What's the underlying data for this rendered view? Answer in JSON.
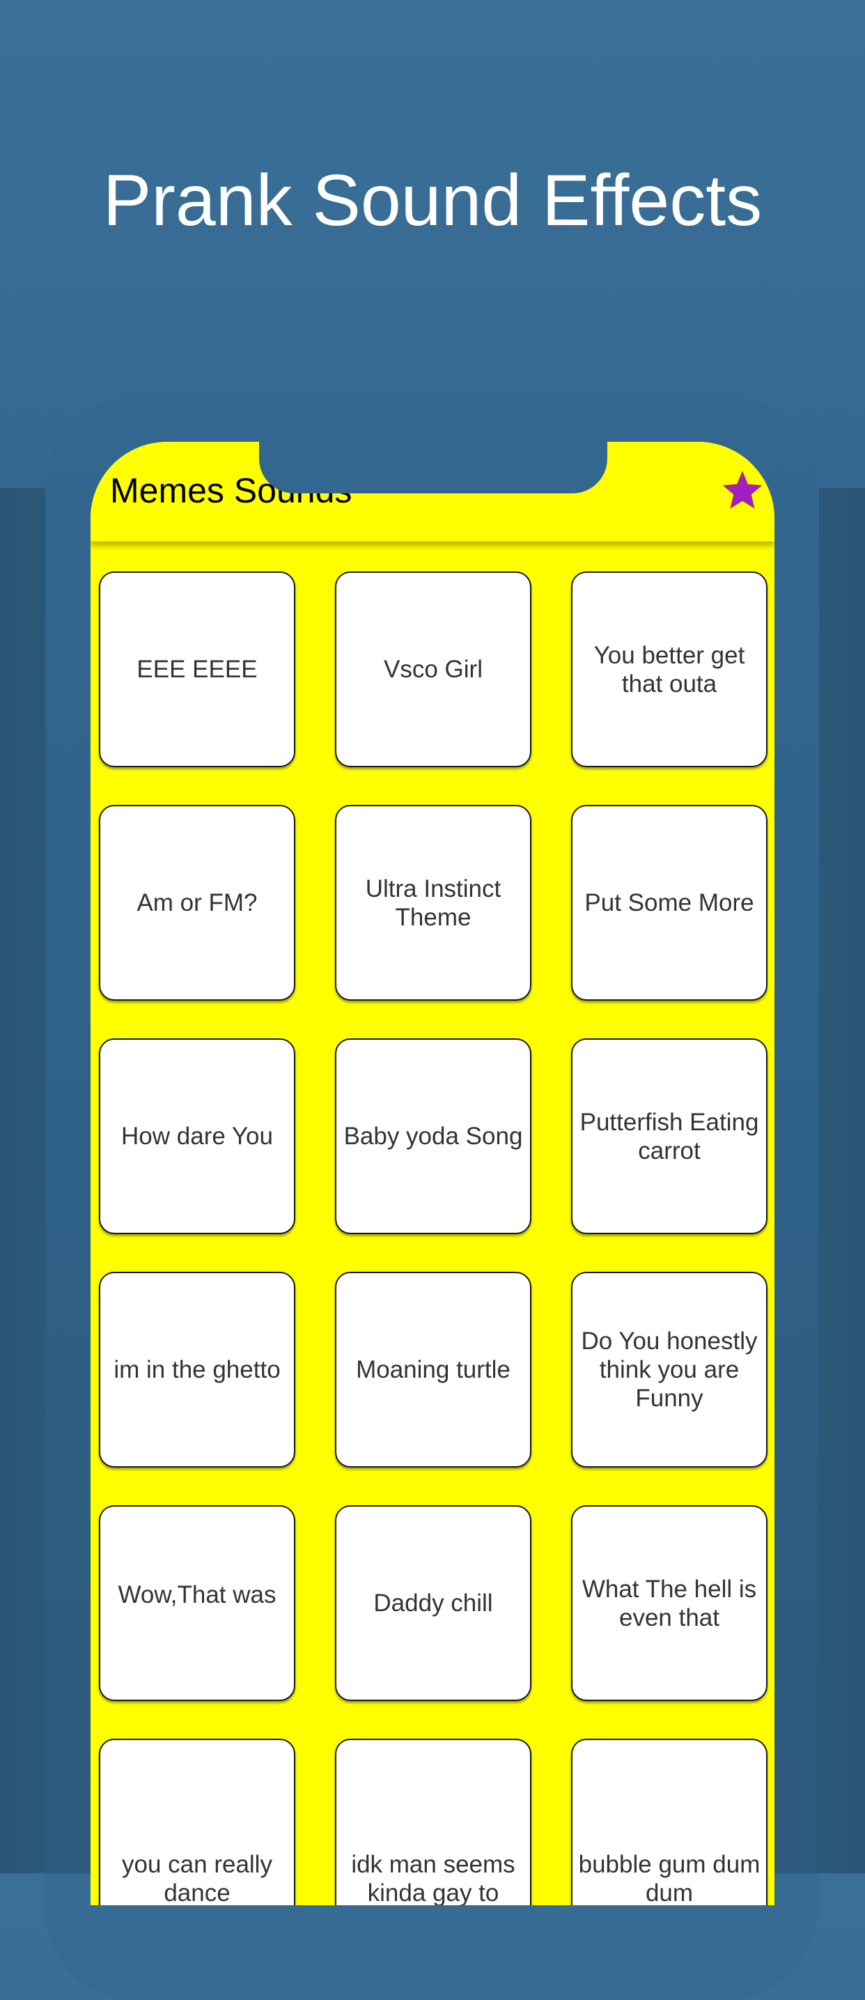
{
  "headline": "Prank Sound Effects",
  "colors": {
    "background": "#346790",
    "screen": "#ffff00",
    "star": "#a020c0",
    "button_border": "#1a1a1a",
    "button_text": "#333333"
  },
  "app": {
    "title": "Memes Sounds",
    "favorites_icon": "star-icon"
  },
  "sounds": [
    {
      "label": "EEE EEEE"
    },
    {
      "label": "Vsco Girl"
    },
    {
      "label": "You better get that outa"
    },
    {
      "label": "Am or FM?"
    },
    {
      "label": "Ultra Instinct Theme"
    },
    {
      "label": "Put Some More"
    },
    {
      "label": "How dare You"
    },
    {
      "label": "Baby yoda Song"
    },
    {
      "label": "Putterfish Eating carrot"
    },
    {
      "label": "im in the ghetto"
    },
    {
      "label": "Moaning turtle"
    },
    {
      "label": "Do You honestly think you are Funny"
    },
    {
      "label": "Wow,That was"
    },
    {
      "label": "Daddy chill"
    },
    {
      "label": "What The hell is even that"
    },
    {
      "label": "you can really dance"
    },
    {
      "label": "idk man seems kinda gay to"
    },
    {
      "label": "bubble gum dum dum"
    }
  ]
}
